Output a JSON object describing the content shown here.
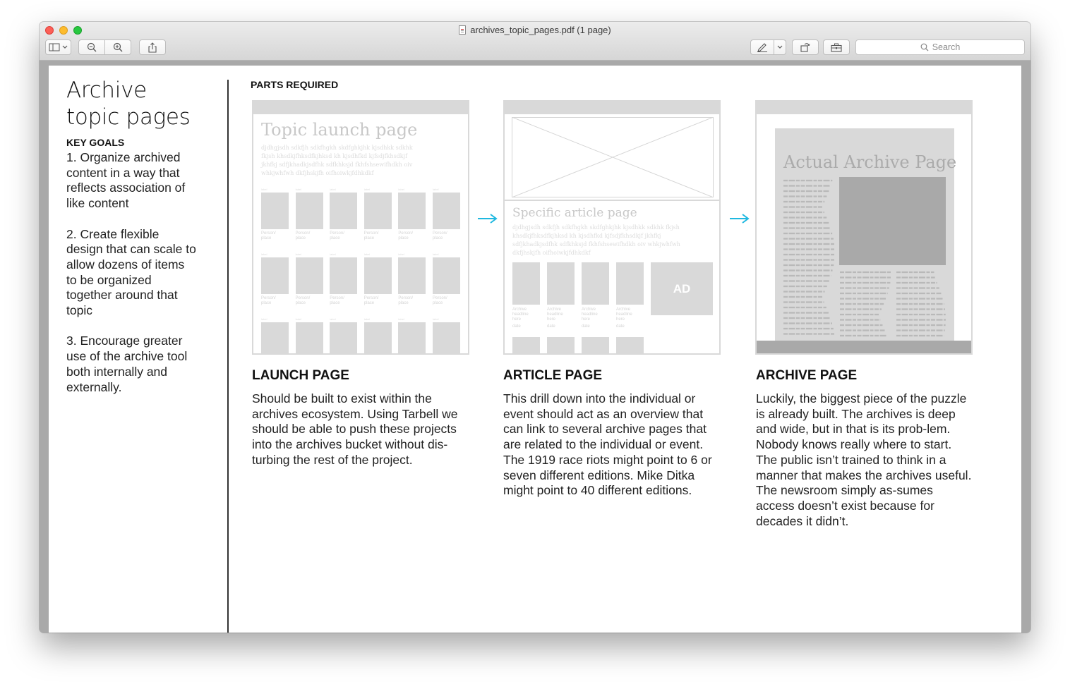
{
  "window": {
    "title": "archives_topic_pages.pdf (1 page)",
    "search_placeholder": "Search"
  },
  "toolbar": {
    "buttons": [
      "sidebar-toggle",
      "zoom-out",
      "zoom-in",
      "share",
      "markup-pen",
      "rotate",
      "toolbox"
    ]
  },
  "goals": {
    "title_line1": "Archive",
    "title_line2": "topic pages",
    "heading": "KEY GOALS",
    "items": [
      "1. Organize archived content in a way that reflects association of like content",
      "2. Create flexible design that can scale to allow dozens of items to be organized together around that topic",
      "3. Encourage greater use of the archive tool both internally and externally."
    ]
  },
  "parts": {
    "heading": "PARTS REQUIRED",
    "arrow_color": "#1fb8e0",
    "launch": {
      "mock_title": "Topic launch page",
      "mock_text": [
        "djdhgjsdh sdkfjh sdkfhgkh skdfghkjhk kjsdhkk sdkhk",
        "fkjsh khsdkjfhksdfkjhksd kh kjsdhfkd kjfsdjfkhsdkjf",
        "jkhfkj sdfjkhadkjsdfhk sdfkhksjd fkhfshsewifhdkh oiv",
        "whkjwhfwh dkfjhskjfh oifhoiwkjfdhkdkf"
      ],
      "cell_tiny": "label",
      "cell_caption": "Person/ place",
      "heading": "LAUNCH PAGE",
      "body": "Should be built to exist within the archives ecosystem. Using Tarbell we should be able to push these projects into the archives bucket without dis-turbing the rest of the project."
    },
    "article": {
      "mock_title": "Specific article page",
      "mock_text": [
        "djdhgjsdh sdkfjh sdkfhgkh skdfghkjhk kjsdhkk sdkhk fkjsh",
        "khsdkjfhksdfkjhksd kh kjsdhfkd kjfsdjfkhsdkjf jkhfkj",
        "sdfjkhadkjsdfhk sdfkhksjd fkhfshsewifhdkh oiv whkjwhfwh",
        "dkfjhskjfh oifhoiwkjfdhkdkf"
      ],
      "cell_caption": "Archive headline here",
      "cell_date": "date",
      "ad_label": "AD",
      "heading": "ARTICLE PAGE",
      "body": "This drill down into the individual or event should act as an overview that can link to several archive pages that are related to the individual or event. The 1919 race riots might point to 6 or seven different editions. Mike Ditka might point to 40 different editions."
    },
    "archive": {
      "mock_title": "Actual Archive Page",
      "heading": "ARCHIVE PAGE",
      "body": "Luckily, the biggest piece of the puzzle is already built. The archives is deep and wide, but in that is its prob-lem. Nobody knows really where to start. The public isn’t trained to think in a manner that makes the archives useful. The newsroom simply as-sumes access doesn’t exist because for decades it didn’t."
    }
  }
}
